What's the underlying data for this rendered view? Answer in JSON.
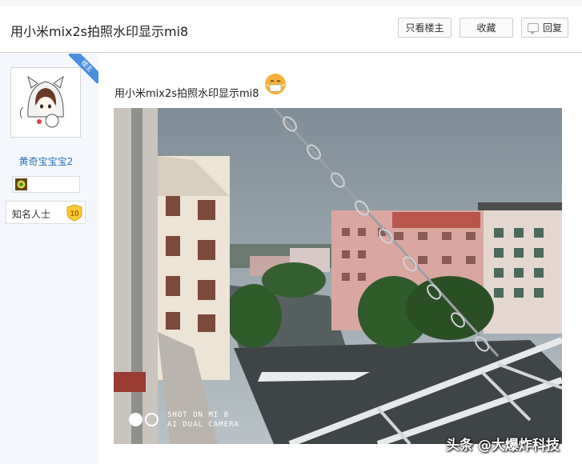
{
  "header": {
    "title": "用小米mix2s拍照水印显示mi8",
    "buttons": {
      "only_op": "只看楼主",
      "favorite": "收藏",
      "reply": "回复"
    }
  },
  "author": {
    "op_badge": "楼主",
    "username": "黄奇宝宝宝2",
    "rank_label": "知名人士",
    "rank_level": "10"
  },
  "post": {
    "text": "用小米mix2s拍照水印显示mi8",
    "photo_watermark_line1": "SHOT ON MI 8",
    "photo_watermark_line2": "AI DUAL CAMERA"
  },
  "overlay": {
    "watermark": "头条 @大爆炸科技"
  }
}
